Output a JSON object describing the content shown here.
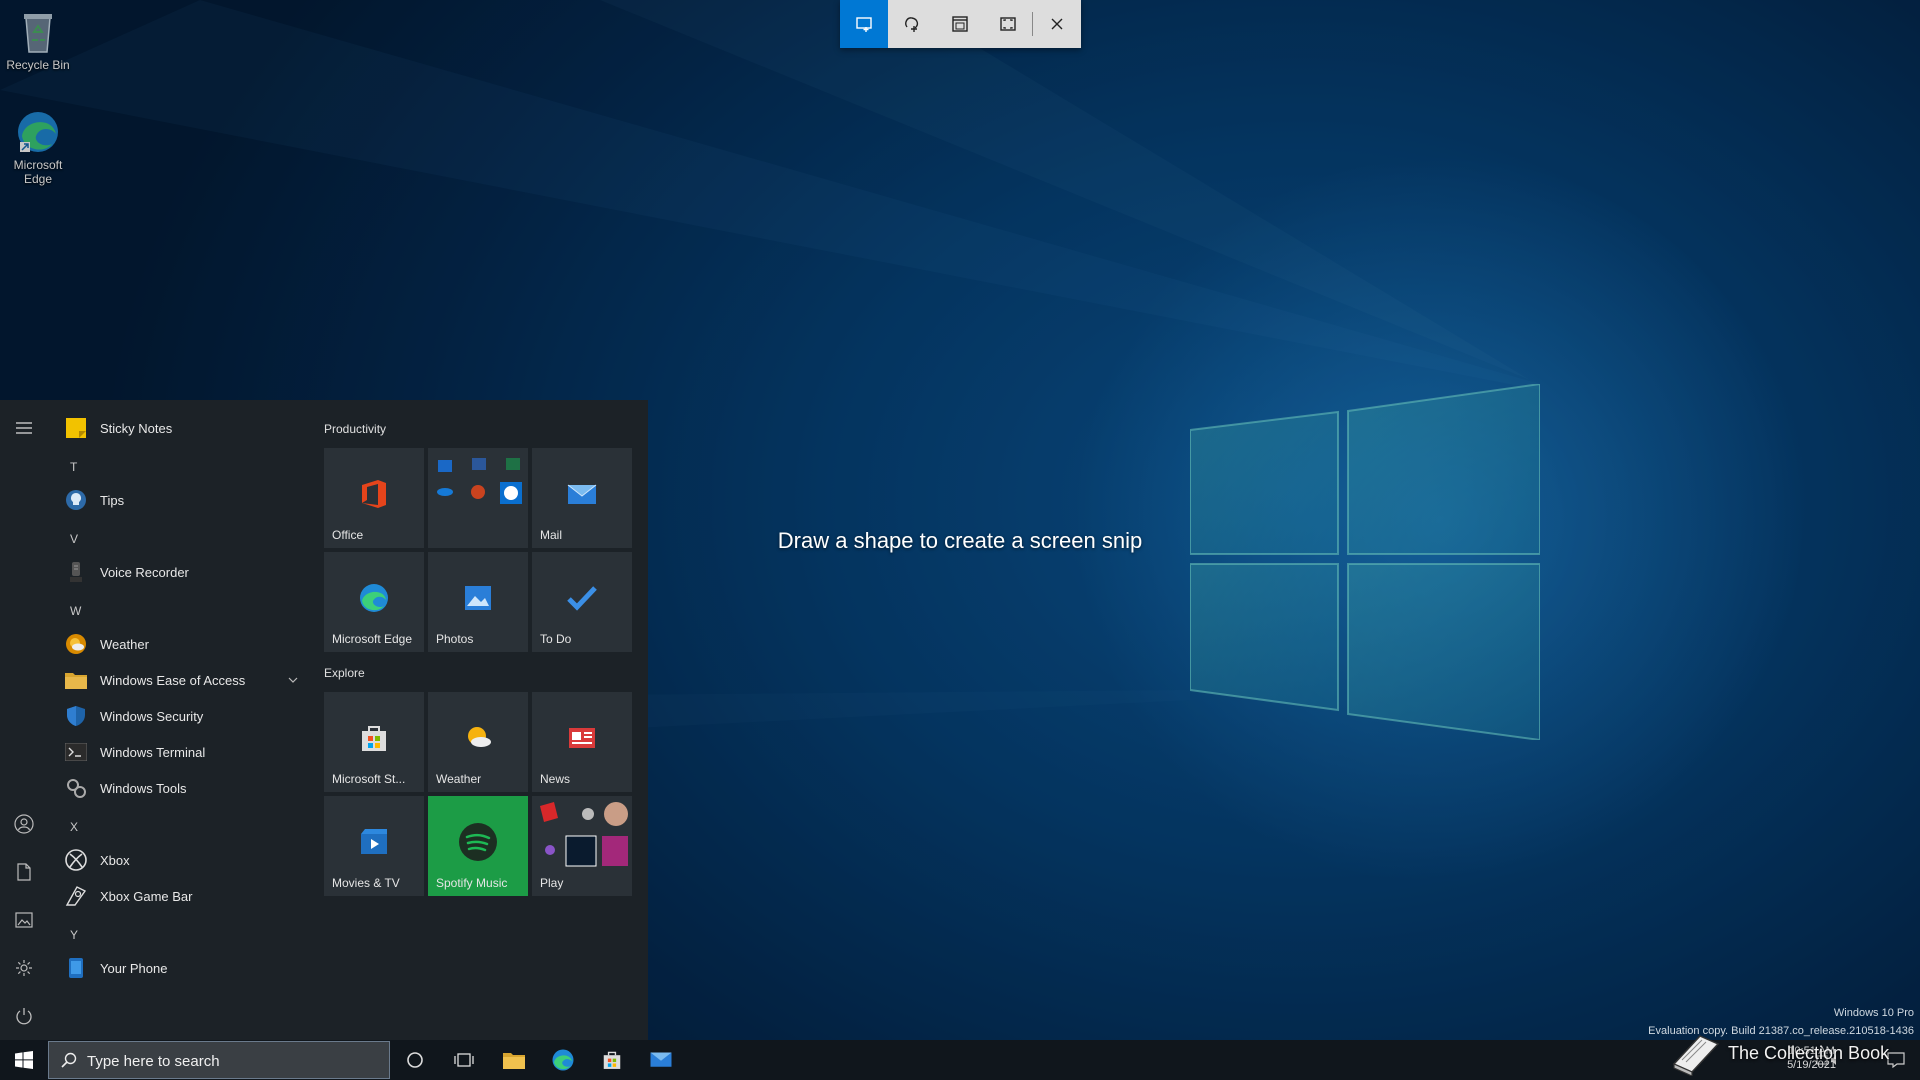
{
  "desktop": {
    "icons": [
      {
        "label": "Recycle Bin"
      },
      {
        "label": "Microsoft Edge"
      }
    ]
  },
  "snip": {
    "modes": [
      "rectangular-snip",
      "freeform-snip",
      "window-snip",
      "fullscreen-snip"
    ],
    "active_mode": "rectangular-snip",
    "message": "Draw a shape to create a screen snip"
  },
  "start_menu": {
    "apps": [
      {
        "type": "app",
        "label": "Sticky Notes"
      },
      {
        "type": "letter",
        "label": "T"
      },
      {
        "type": "app",
        "label": "Tips"
      },
      {
        "type": "letter",
        "label": "V"
      },
      {
        "type": "app",
        "label": "Voice Recorder"
      },
      {
        "type": "letter",
        "label": "W"
      },
      {
        "type": "app",
        "label": "Weather"
      },
      {
        "type": "app",
        "label": "Windows Ease of Access"
      },
      {
        "type": "app",
        "label": "Windows Security"
      },
      {
        "type": "app",
        "label": "Windows Terminal"
      },
      {
        "type": "app",
        "label": "Windows Tools"
      },
      {
        "type": "letter",
        "label": "X"
      },
      {
        "type": "app",
        "label": "Xbox"
      },
      {
        "type": "app",
        "label": "Xbox Game Bar"
      },
      {
        "type": "letter",
        "label": "Y"
      },
      {
        "type": "app",
        "label": "Your Phone"
      }
    ],
    "groups": [
      {
        "title": "Productivity",
        "tiles": [
          "Office",
          "",
          "Mail",
          "Microsoft Edge",
          "Photos",
          "To Do"
        ]
      },
      {
        "title": "Explore",
        "tiles": [
          "Microsoft St...",
          "Weather",
          "News",
          "Movies & TV",
          "Spotify Music",
          "Play"
        ]
      }
    ]
  },
  "taskbar": {
    "search_placeholder": "Type here to search",
    "clock_time": "10:51 AM",
    "clock_date": "5/19/2021"
  },
  "watermark": {
    "line1": "Windows 10 Pro",
    "line2": "Evaluation copy. Build 21387.co_release.210518-1436"
  },
  "brand": {
    "label": "The Collection Book"
  },
  "colors": {
    "accent": "#0078d4",
    "spotify": "#1db954",
    "start_bg": "#1c2227"
  }
}
